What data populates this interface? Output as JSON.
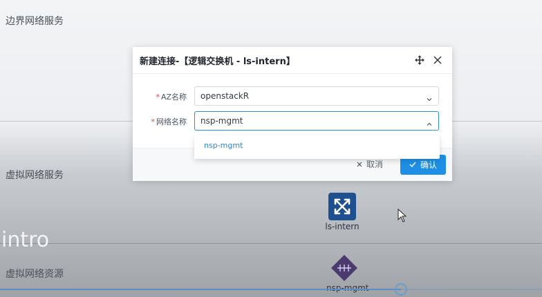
{
  "background": {
    "sections": [
      {
        "label": "边界网络服务"
      },
      {
        "label": "虚拟网络服务"
      },
      {
        "label": "虚拟网络资源"
      }
    ],
    "nodes": [
      {
        "label": "ls-intern",
        "icon": "switch-icon",
        "color": "#1e4f8f"
      },
      {
        "label": "nsp-mgmt",
        "icon": "network-icon",
        "color": "#4a3a6e"
      }
    ],
    "overlay_text": "intro",
    "video_progress": 0.74
  },
  "dialog": {
    "title": "新建连接-【逻辑交换机 - ls-intern】",
    "move_icon": "move-icon",
    "close_icon": "close-icon",
    "fields": [
      {
        "required_mark": "*",
        "label": "AZ名称",
        "value": "openstackR",
        "arrow": "chevron-down-icon"
      },
      {
        "required_mark": "*",
        "label": "网络名称",
        "value": "nsp-mgmt",
        "arrow": "chevron-up-icon"
      }
    ],
    "dropdown_options": [
      "nsp-mgmt"
    ],
    "cancel_label": "取消",
    "confirm_label": "确认",
    "accent_color": "#1e8fe5"
  }
}
